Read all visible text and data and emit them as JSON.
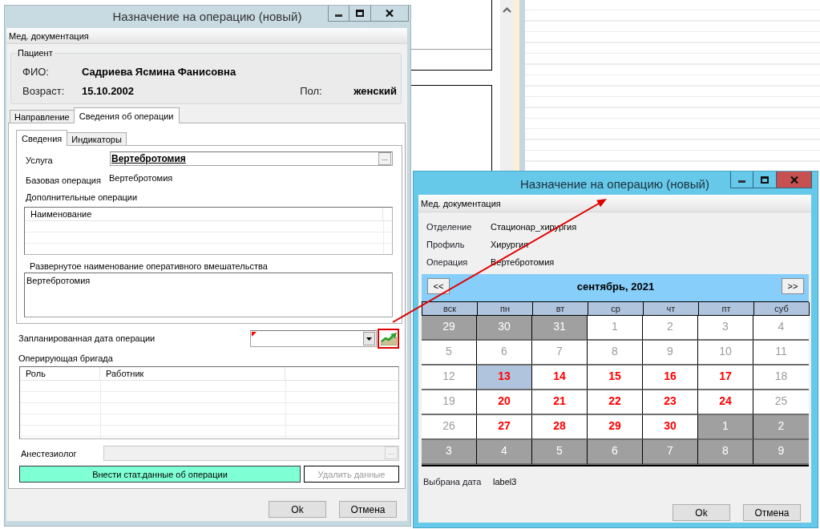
{
  "main_window": {
    "title": "Назначение на операцию (новый)",
    "active": false,
    "menu": [
      {
        "label": "Мед. документация"
      }
    ],
    "patient": {
      "legend": "Пациент",
      "name_label": "ФИО:",
      "name": "Садриева Ясмина Фанисовна",
      "age_label": "Возраст:",
      "age": "15.10.2002",
      "sex_label": "Пол:",
      "sex": "женский"
    },
    "tabs": [
      {
        "label": "Направление",
        "selected": false
      },
      {
        "label": "Сведения об операции",
        "selected": true
      }
    ],
    "subtabs": [
      {
        "label": "Сведения",
        "selected": true
      },
      {
        "label": "Индикаторы",
        "selected": false
      }
    ],
    "service": {
      "label": "Услуга",
      "value": "Вертебротомия",
      "button": "..."
    },
    "base_operation": {
      "label": "Базовая операция",
      "value": "Вертебротомия"
    },
    "additional_operations": {
      "label": "Дополнительные операции",
      "columns": [
        "Наименование"
      ]
    },
    "full_name": {
      "label": "Развернутое наименование оперативного вмешательства",
      "value": "Вертебротомия"
    },
    "planned_date": {
      "label": "Запланированная дата операции",
      "required": true,
      "highlighted": true
    },
    "team": {
      "label": "Оперирующая бригада",
      "columns": [
        "Роль",
        "Работник"
      ]
    },
    "anesthesiologist": {
      "label": "Анестезиолог",
      "button": "...",
      "disabled": true
    },
    "actions": [
      {
        "label": "Внести стат.данные об операции",
        "kind": "accent",
        "disabled": false
      },
      {
        "label": "Удалить данные",
        "kind": "plain",
        "disabled": true
      }
    ],
    "buttons": [
      {
        "label": "Ok"
      },
      {
        "label": "Отмена"
      }
    ]
  },
  "calendar_window": {
    "title": "Назначение на операцию (новый)",
    "active": true,
    "menu": [
      {
        "label": "Мед. документация"
      }
    ],
    "info": [
      {
        "label": "Отделение",
        "value": "Стационар_хирургия"
      },
      {
        "label": "Профиль",
        "value": "Хирургия"
      },
      {
        "label": "Операция",
        "value": "Вертебротомия"
      }
    ],
    "calendar": {
      "prev": "<<",
      "next": ">>",
      "month": "сентябрь, 2021",
      "weekdays": [
        "вск",
        "пн",
        "вт",
        "ср",
        "чт",
        "пт",
        "суб"
      ],
      "days": [
        {
          "day": "29",
          "kind": "other",
          "selected": false
        },
        {
          "day": "30",
          "kind": "other",
          "selected": false
        },
        {
          "day": "31",
          "kind": "other",
          "selected": false
        },
        {
          "day": "1",
          "kind": "unavailable",
          "selected": false
        },
        {
          "day": "2",
          "kind": "unavailable",
          "selected": false
        },
        {
          "day": "3",
          "kind": "unavailable",
          "selected": false
        },
        {
          "day": "4",
          "kind": "unavailable",
          "selected": false
        },
        {
          "day": "5",
          "kind": "unavailable",
          "selected": false
        },
        {
          "day": "6",
          "kind": "unavailable",
          "selected": false
        },
        {
          "day": "7",
          "kind": "unavailable",
          "selected": false
        },
        {
          "day": "8",
          "kind": "unavailable",
          "selected": false
        },
        {
          "day": "9",
          "kind": "unavailable",
          "selected": false
        },
        {
          "day": "10",
          "kind": "unavailable",
          "selected": false
        },
        {
          "day": "11",
          "kind": "unavailable",
          "selected": false
        },
        {
          "day": "12",
          "kind": "unavailable",
          "selected": false
        },
        {
          "day": "13",
          "kind": "available",
          "selected": true
        },
        {
          "day": "14",
          "kind": "available",
          "selected": false
        },
        {
          "day": "15",
          "kind": "available",
          "selected": false
        },
        {
          "day": "16",
          "kind": "available",
          "selected": false
        },
        {
          "day": "17",
          "kind": "available",
          "selected": false
        },
        {
          "day": "18",
          "kind": "unavailable",
          "selected": false
        },
        {
          "day": "19",
          "kind": "unavailable",
          "selected": false
        },
        {
          "day": "20",
          "kind": "available",
          "selected": false
        },
        {
          "day": "21",
          "kind": "available",
          "selected": false
        },
        {
          "day": "22",
          "kind": "available",
          "selected": false
        },
        {
          "day": "23",
          "kind": "available",
          "selected": false
        },
        {
          "day": "24",
          "kind": "available",
          "selected": false
        },
        {
          "day": "25",
          "kind": "unavailable",
          "selected": false
        },
        {
          "day": "26",
          "kind": "unavailable",
          "selected": false
        },
        {
          "day": "27",
          "kind": "available",
          "selected": false
        },
        {
          "day": "28",
          "kind": "available",
          "selected": false
        },
        {
          "day": "29",
          "kind": "available",
          "selected": false
        },
        {
          "day": "30",
          "kind": "available",
          "selected": false
        },
        {
          "day": "1",
          "kind": "other",
          "selected": false
        },
        {
          "day": "2",
          "kind": "other",
          "selected": false
        },
        {
          "day": "3",
          "kind": "other",
          "selected": false
        },
        {
          "day": "4",
          "kind": "other",
          "selected": false
        },
        {
          "day": "5",
          "kind": "other",
          "selected": false
        },
        {
          "day": "6",
          "kind": "other",
          "selected": false
        },
        {
          "day": "7",
          "kind": "other",
          "selected": false
        },
        {
          "day": "8",
          "kind": "other",
          "selected": false
        },
        {
          "day": "9",
          "kind": "other",
          "selected": false
        }
      ]
    },
    "selected_date": {
      "label": "Выбрана дата",
      "value": "label3"
    },
    "buttons": [
      {
        "label": "Ok"
      },
      {
        "label": "Отмена"
      }
    ]
  }
}
